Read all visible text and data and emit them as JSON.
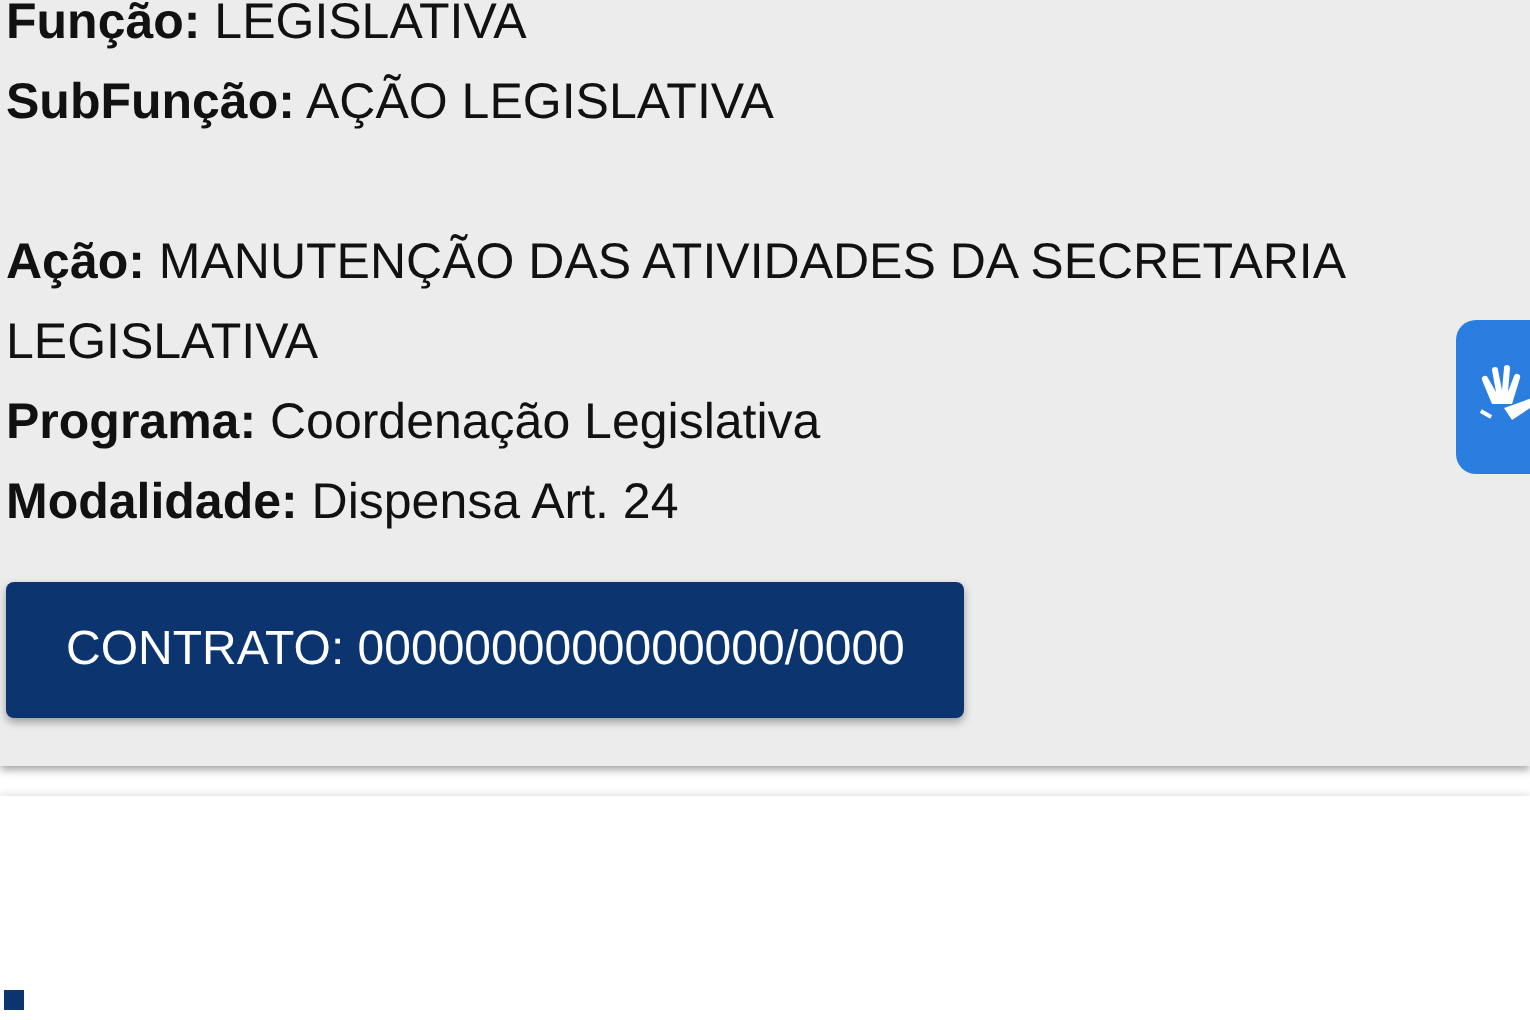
{
  "detail_groups": [
    [
      {
        "label": "Função:",
        "value": "LEGISLATIVA"
      },
      {
        "label": "SubFunção:",
        "value": "AÇÃO LEGISLATIVA"
      }
    ],
    [
      {
        "label": "Ação:",
        "value": "MANUTENÇÃO DAS ATIVIDADES DA SECRETARIA LEGISLATIVA"
      },
      {
        "label": "Programa:",
        "value": "Coordenação Legislativa"
      },
      {
        "label": "Modalidade:",
        "value": "Dispensa Art. 24"
      }
    ]
  ],
  "contract_button": "CONTRATO: 0000000000000000/0000"
}
